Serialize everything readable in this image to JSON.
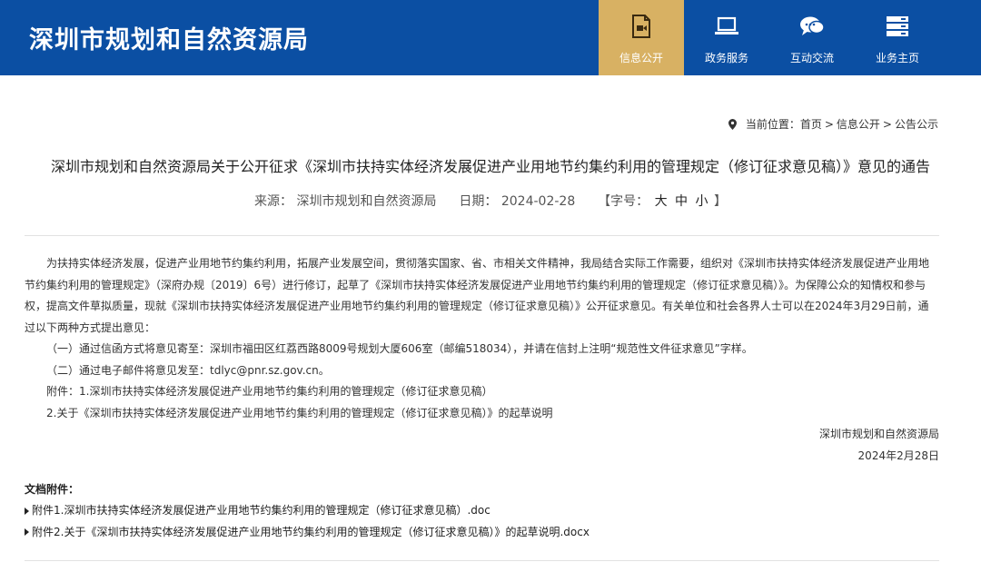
{
  "site": {
    "title": "深圳市规划和自然资源局"
  },
  "nav": [
    {
      "label": "信息公开",
      "icon": "document-video-icon",
      "active": true
    },
    {
      "label": "政务服务",
      "icon": "laptop-icon",
      "active": false
    },
    {
      "label": "互动交流",
      "icon": "chat-bubbles-icon",
      "active": false
    },
    {
      "label": "业务主页",
      "icon": "server-stack-icon",
      "active": false
    }
  ],
  "breadcrumb": {
    "prefix": "当前位置：",
    "items": [
      "首页",
      "信息公开",
      "公告公示"
    ],
    "separator": ">"
  },
  "article": {
    "title": "深圳市规划和自然资源局关于公开征求《深圳市扶持实体经济发展促进产业用地节约集约利用的管理规定（修订征求意见稿）》意见的通告",
    "source_label": "来源：",
    "source": "深圳市规划和自然资源局",
    "date_label": "日期：",
    "date": "2024-02-28",
    "fontsize_label": "【字号：",
    "fontsize_large": "大",
    "fontsize_medium": "中",
    "fontsize_small": "小",
    "fontsize_close": "】",
    "paragraphs": {
      "p1": "为扶持实体经济发展，促进产业用地节约集约利用，拓展产业发展空间，贯彻落实国家、省、市相关文件精神，我局结合实际工作需要，组织对《深圳市扶持实体经济发展促进产业用地节约集约利用的管理规定》（深府办规〔2019〕6号）进行修订，起草了《深圳市扶持实体经济发展促进产业用地节约集约利用的管理规定（修订征求意见稿）》。为保障公众的知情权和参与权，提高文件草拟质量，现就《深圳市扶持实体经济发展促进产业用地节约集约利用的管理规定（修订征求意见稿）》公开征求意见。有关单位和社会各界人士可以在2024年3月29日前，通过以下两种方式提出意见：",
      "p2": "（一）通过信函方式将意见寄至：深圳市福田区红荔西路8009号规划大厦606室（邮编518034），并请在信封上注明“规范性文件征求意见”字样。",
      "p3": "（二）通过电子邮件将意见发至：tdlyc@pnr.sz.gov.cn。",
      "p4": "附件：1.深圳市扶持实体经济发展促进产业用地节约集约利用的管理规定（修订征求意见稿）",
      "p5": "2.关于《深圳市扶持实体经济发展促进产业用地节约集约利用的管理规定（修订征求意见稿）》的起草说明",
      "signature": "深圳市规划和自然资源局",
      "sign_date": "2024年2月28日"
    }
  },
  "attachments": {
    "title": "文档附件：",
    "items": [
      "附件1.深圳市扶持实体经济发展促进产业用地节约集约利用的管理规定（修订征求意见稿）.doc",
      "附件2.关于《深圳市扶持实体经济发展促进产业用地节约集约利用的管理规定（修订征求意见稿）》的起草说明.docx"
    ]
  },
  "colors": {
    "header_bg": "#0b4fa3",
    "nav_active": "#d8b163",
    "text": "#333333"
  }
}
